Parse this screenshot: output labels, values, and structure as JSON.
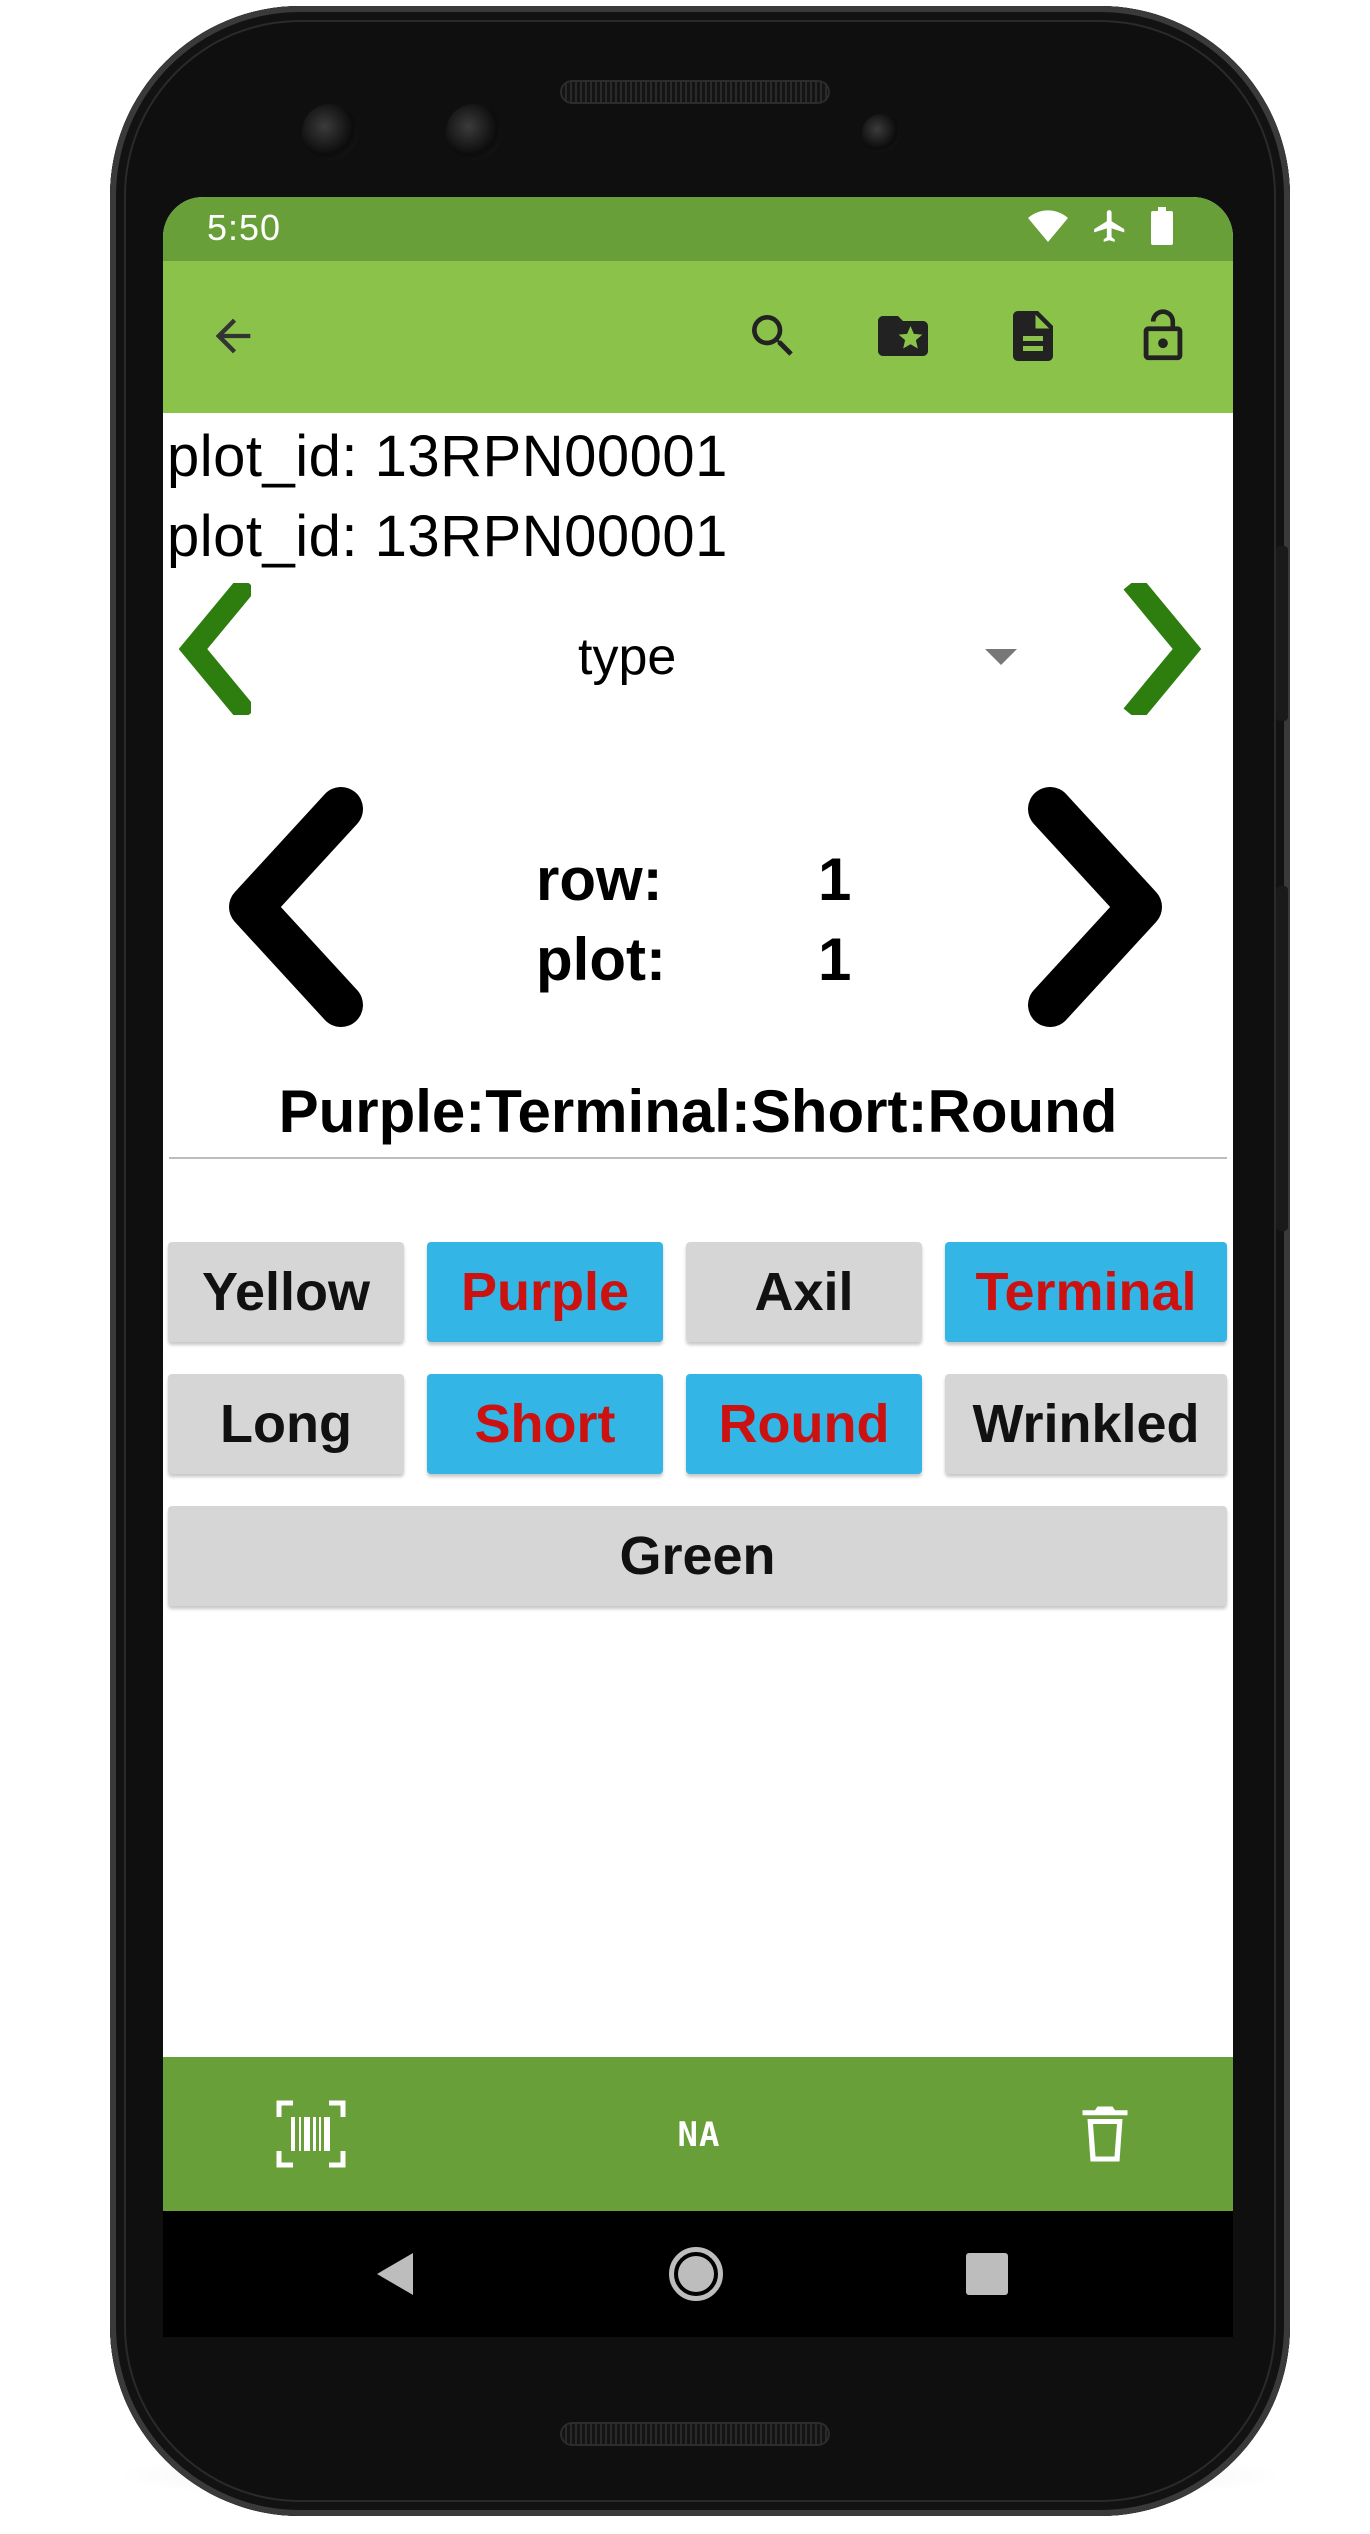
{
  "status_bar": {
    "time": "5:50"
  },
  "app_bar": {
    "back_icon": "arrow-back-icon",
    "actions": [
      "search-icon",
      "folder-star-icon",
      "document-icon",
      "lock-open-icon"
    ]
  },
  "header": {
    "line1": "plot_id: 13RPN00001",
    "line2": "plot_id: 13RPN00001"
  },
  "trait_spinner": {
    "selected": "type"
  },
  "position": {
    "row_label": "row:",
    "row_value": "1",
    "plot_label": "plot:",
    "plot_value": "1"
  },
  "value_summary": "Purple:Terminal:Short:Round",
  "categories": [
    {
      "label": "Yellow",
      "selected": false
    },
    {
      "label": "Purple",
      "selected": true
    },
    {
      "label": "Axil",
      "selected": false
    },
    {
      "label": "Terminal",
      "selected": true
    },
    {
      "label": "Long",
      "selected": false
    },
    {
      "label": "Short",
      "selected": true
    },
    {
      "label": "Round",
      "selected": true
    },
    {
      "label": "Wrinkled",
      "selected": false
    },
    {
      "label": "Green",
      "selected": false
    }
  ],
  "bottom_bar": {
    "barcode_icon": "barcode-scan-icon",
    "na_label": "NA",
    "delete_icon": "trash-icon"
  },
  "colors": {
    "status_bar": "#689f38",
    "app_bar": "#8bc34a",
    "bottom_bar": "#689f38",
    "selected_button": "#33b5e5",
    "selected_text": "#cc1111",
    "unselected_button": "#d6d6d6",
    "nav_arrow_green": "#2e7d0f"
  }
}
